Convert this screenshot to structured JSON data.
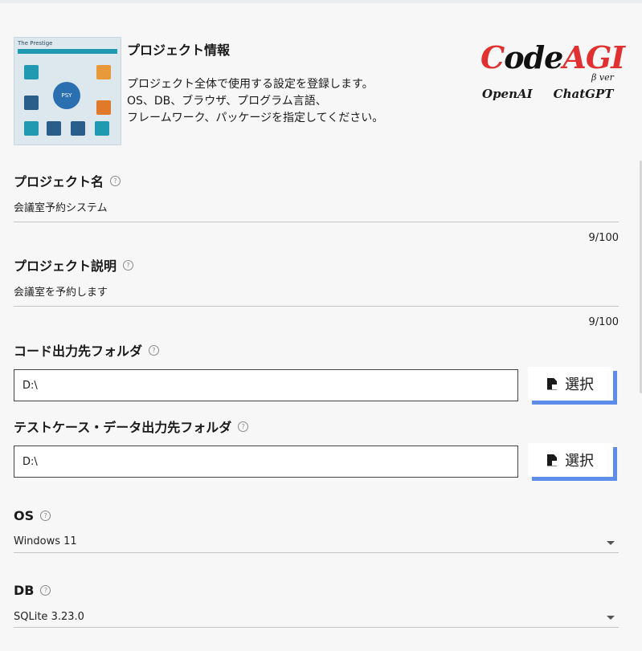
{
  "header": {
    "thumbnail_caption": "The Prestige",
    "thumbnail_hub_text": "PSY",
    "title": "プロジェクト情報",
    "description": "プロジェクト全体で使用する設定を登録します。\nOS、DB、ブラウザ、プログラム言語、\nフレームワーク、パッケージを指定してください。",
    "logo": {
      "part1": "C",
      "part2": "ode",
      "part3": "AGI",
      "beta": "β ver",
      "sub1": "OpenAI",
      "sub2": "ChatGPT",
      "accent_color": "#e03030"
    }
  },
  "form": {
    "project_name": {
      "label": "プロジェクト名",
      "value": "会議室予約システム",
      "counter": "9/100"
    },
    "project_description": {
      "label": "プロジェクト説明",
      "value": "会議室を予約します",
      "counter": "9/100"
    },
    "code_output_folder": {
      "label": "コード出力先フォルダ",
      "value": "D:\\",
      "button_label": "選択"
    },
    "testcase_output_folder": {
      "label": "テストケース・データ出力先フォルダ",
      "value": "D:\\",
      "button_label": "選択"
    },
    "os": {
      "label": "OS",
      "value": "Windows 11"
    },
    "db": {
      "label": "DB",
      "value": "SQLite 3.23.0"
    }
  },
  "icons": {
    "help": "help-circle-icon",
    "file": "file-select-icon",
    "dropdown": "caret-down-icon"
  },
  "colors": {
    "button_shadow": "#5c8de8",
    "background": "#f7f7f7"
  }
}
